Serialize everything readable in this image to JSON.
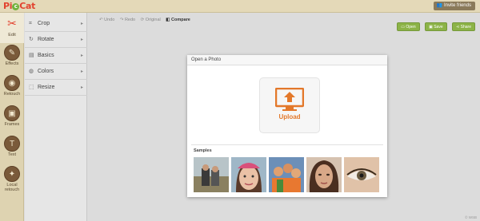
{
  "app": {
    "logo": "PicMonkey-like",
    "logo_text_pre": "Pi",
    "logo_o": "c",
    "logo_text_post": "Cat",
    "invite_label": "Invite friends"
  },
  "rail": {
    "items": [
      {
        "label": "Edit",
        "icon": "scissors-icon",
        "glyph": "✂"
      },
      {
        "label": "Effects",
        "icon": "wand-icon",
        "glyph": "✎"
      },
      {
        "label": "Retouch",
        "icon": "lipstick-icon",
        "glyph": "◉"
      },
      {
        "label": "Frames",
        "icon": "frame-icon",
        "glyph": "▣"
      },
      {
        "label": "Text",
        "icon": "text-icon",
        "glyph": "T"
      },
      {
        "label": "Local retouch",
        "icon": "local-retouch-icon",
        "glyph": "✦"
      }
    ]
  },
  "submenu": {
    "items": [
      {
        "label": "Crop",
        "icon": "crop-icon",
        "glyph": "⌗"
      },
      {
        "label": "Rotate",
        "icon": "rotate-icon",
        "glyph": "↻"
      },
      {
        "label": "Basics",
        "icon": "basics-icon",
        "glyph": "▤"
      },
      {
        "label": "Colors",
        "icon": "colors-icon",
        "glyph": "◍"
      },
      {
        "label": "Resize",
        "icon": "resize-icon",
        "glyph": "⬚"
      }
    ],
    "arrow": "▸"
  },
  "toolbar": {
    "undo": "↶ Undo",
    "redo": "↷ Redo",
    "original": "⟳ Original",
    "compare": "◧ Compare"
  },
  "actions": {
    "open": "Open",
    "save": "Save",
    "share": "Share"
  },
  "dialog": {
    "title": "Open a Photo",
    "upload_label": "Upload",
    "samples_label": "Samples"
  },
  "colors": {
    "accent_orange": "#e3782a",
    "green": "#8cb347",
    "rail": "#ded3b1"
  },
  "footer": {
    "credit": "© WSB"
  }
}
